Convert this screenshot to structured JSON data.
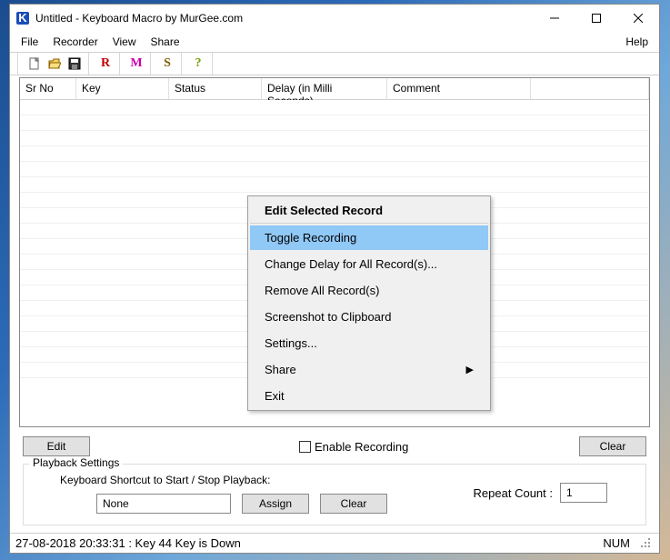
{
  "title": "Untitled - Keyboard Macro by MurGee.com",
  "menubar": {
    "file": "File",
    "recorder": "Recorder",
    "view": "View",
    "share": "Share",
    "help": "Help"
  },
  "toolbar": {
    "r_char": "R",
    "m_char": "M",
    "s_char": "S",
    "q_char": "?",
    "r_color": "#c00000",
    "m_color": "#cc00aa",
    "s_color": "#806000",
    "q_color": "#70a000"
  },
  "columns": {
    "srno": "Sr No",
    "key": "Key",
    "status": "Status",
    "delay": "Delay (in Milli Seconds)",
    "comment": "Comment"
  },
  "buttons": {
    "edit": "Edit",
    "clear": "Clear",
    "assign": "Assign",
    "clear2": "Clear"
  },
  "checkbox": {
    "enable_recording": "Enable Recording"
  },
  "playback": {
    "legend": "Playback Settings",
    "shortcut_label": "Keyboard Shortcut to Start / Stop Playback:",
    "shortcut_value": "None",
    "repeat_label": "Repeat Count :",
    "repeat_value": "1"
  },
  "statusbar": {
    "left": "27-08-2018 20:33:31 : Key 44 Key is Down",
    "num": "NUM"
  },
  "context_menu": {
    "header": "Edit Selected Record",
    "items": [
      {
        "label": "Toggle Recording",
        "selected": true
      },
      {
        "label": "Change Delay for All Record(s)..."
      },
      {
        "label": "Remove All Record(s)"
      },
      {
        "label": "Screenshot to Clipboard"
      },
      {
        "label": "Settings..."
      },
      {
        "label": "Share",
        "submenu": true
      },
      {
        "label": "Exit"
      }
    ]
  }
}
